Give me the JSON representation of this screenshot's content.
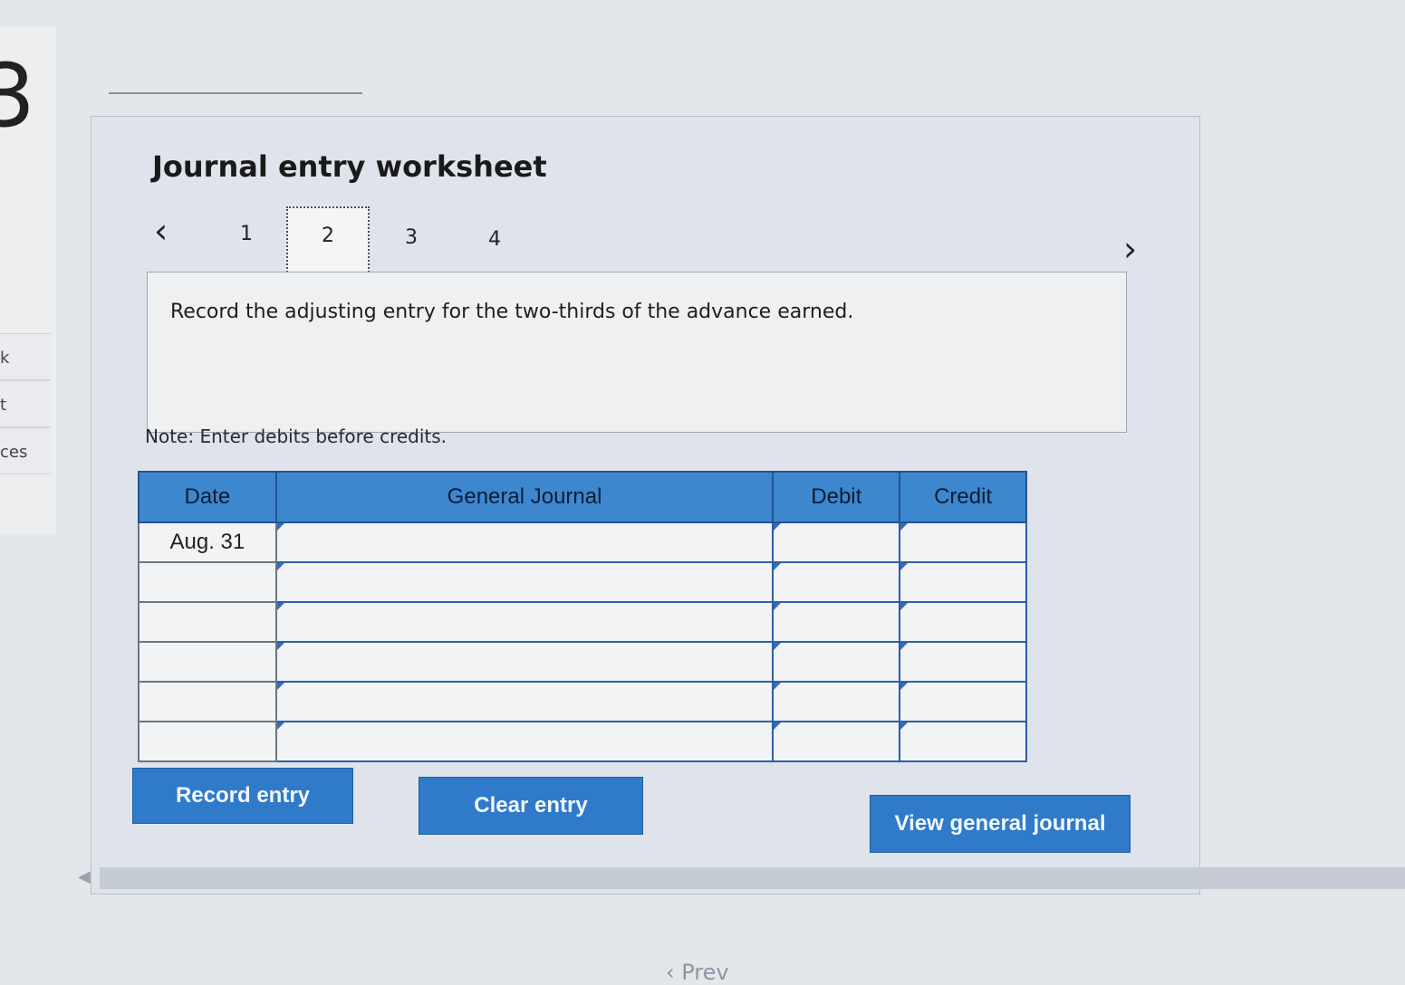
{
  "sidebar": {
    "step_number": "3",
    "items": [
      "k",
      "t",
      "ces"
    ]
  },
  "worksheet": {
    "title": "Journal entry worksheet",
    "steps": [
      "1",
      "2",
      "3",
      "4"
    ],
    "active_step": "2",
    "prompt": "Record the adjusting entry for the two-thirds of the advance earned.",
    "note": "Note: Enter debits before credits."
  },
  "journal": {
    "headers": [
      "Date",
      "General Journal",
      "Debit",
      "Credit"
    ],
    "rows": [
      {
        "date": "Aug. 31",
        "account": "",
        "debit": "",
        "credit": ""
      },
      {
        "date": "",
        "account": "",
        "debit": "",
        "credit": ""
      },
      {
        "date": "",
        "account": "",
        "debit": "",
        "credit": ""
      },
      {
        "date": "",
        "account": "",
        "debit": "",
        "credit": ""
      },
      {
        "date": "",
        "account": "",
        "debit": "",
        "credit": ""
      },
      {
        "date": "",
        "account": "",
        "debit": "",
        "credit": ""
      }
    ]
  },
  "buttons": {
    "record": "Record entry",
    "clear": "Clear entry",
    "view": "View general journal"
  },
  "footer": {
    "prev_label": "Prev"
  },
  "colors": {
    "accent": "#2f7ac9",
    "header": "#3d87cf"
  }
}
